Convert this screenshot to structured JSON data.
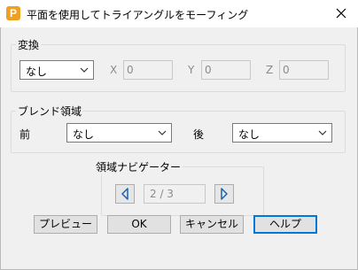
{
  "window": {
    "title": "平面を使用してトライアングルをモーフィング",
    "app_icon_letter": "P",
    "icons": {
      "app": "app-logo-icon",
      "close": "close-icon"
    }
  },
  "transform": {
    "group_label": "変換",
    "selected": "なし",
    "x_label": "X",
    "x_value": "0",
    "y_label": "Y",
    "y_value": "0",
    "z_label": "Z",
    "z_value": "0"
  },
  "blend": {
    "group_label": "ブレンド領域",
    "front_label": "前",
    "front_selected": "なし",
    "back_label": "後",
    "back_selected": "なし"
  },
  "navigator": {
    "group_label": "領域ナビゲーター",
    "page_text": "2 / 3",
    "icons": {
      "prev": "arrow-left-icon",
      "next": "arrow-right-icon"
    }
  },
  "buttons": {
    "preview": "プレビュー",
    "ok": "OK",
    "cancel": "キャンセル",
    "help": "ヘルプ"
  },
  "colors": {
    "accent": "#0078d7",
    "dialog_bg": "#f0f0f0",
    "app_icon_bg": "#f0a020",
    "nav_arrow": "#1a63b0"
  }
}
